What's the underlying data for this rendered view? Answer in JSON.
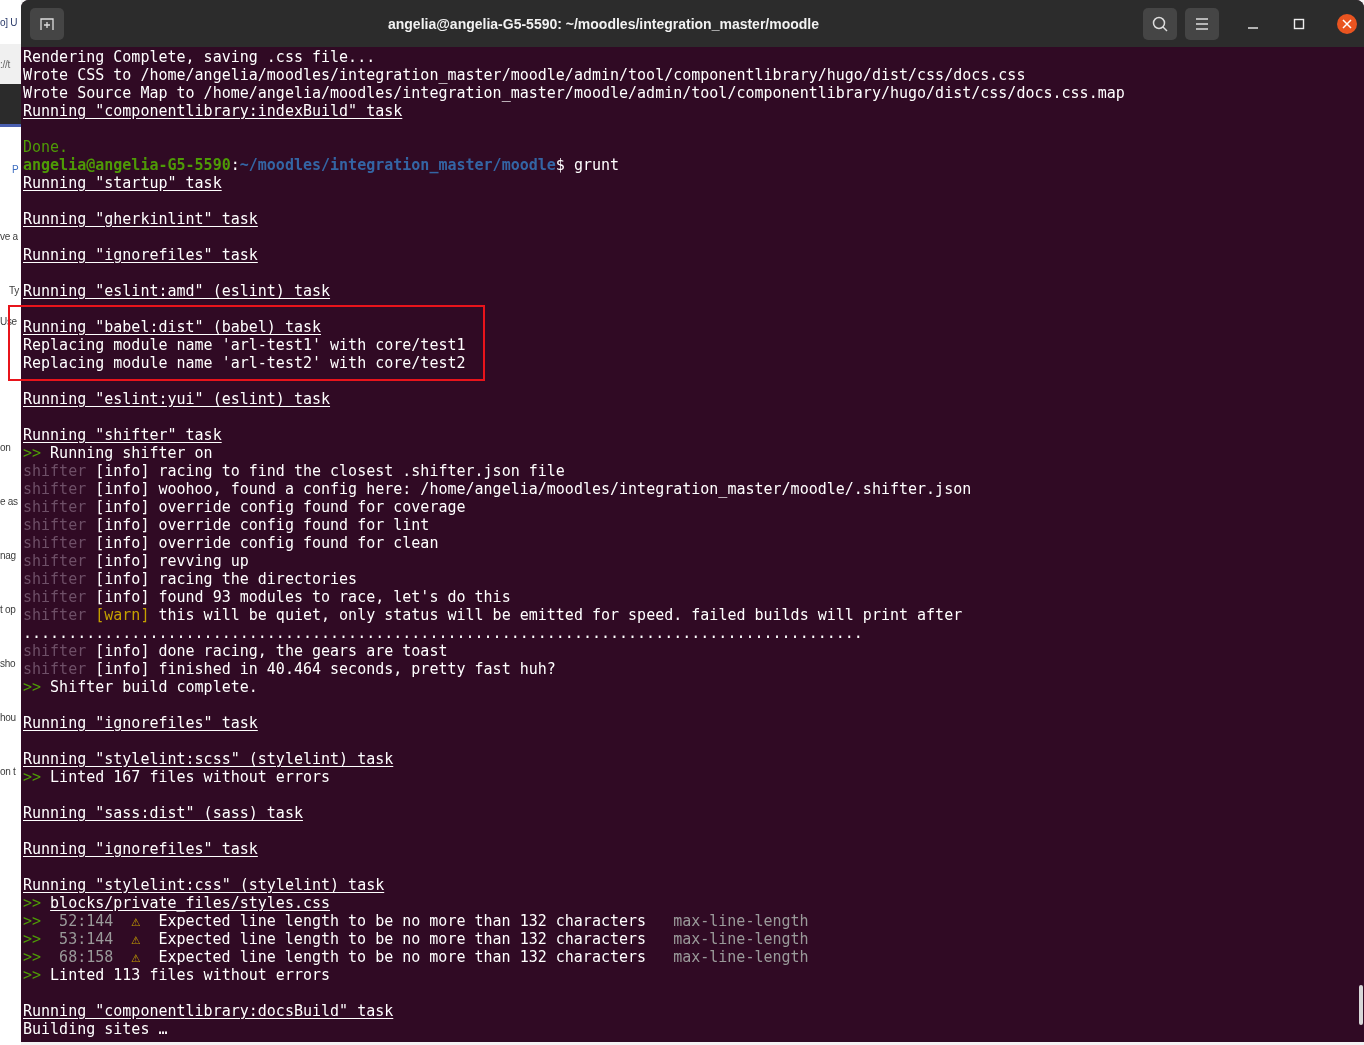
{
  "background_window": {
    "fragments": [
      "o] U",
      "://t",
      "P",
      "ve a",
      "Ty",
      "Use",
      "on",
      "e as",
      "nag",
      "t op",
      "sho",
      "hou",
      "on t"
    ]
  },
  "window": {
    "title": "angelia@angelia-G5-5590: ~/moodles/integration_master/moodle"
  },
  "lines": [
    {
      "kind": "text",
      "segments": [
        {
          "kind": "plain",
          "text": "Rendering Complete, saving .css file..."
        }
      ]
    },
    {
      "kind": "text",
      "segments": [
        {
          "kind": "plain",
          "text": "Wrote CSS to /home/angelia/moodles/integration_master/moodle/admin/tool/componentlibrary/hugo/dist/css/docs.css"
        }
      ]
    },
    {
      "kind": "text",
      "segments": [
        {
          "kind": "plain",
          "text": "Wrote Source Map to /home/angelia/moodles/integration_master/moodle/admin/tool/componentlibrary/hugo/dist/css/docs.css.map"
        }
      ]
    },
    {
      "kind": "text",
      "segments": [
        {
          "kind": "task",
          "text": "Running \"componentlibrary:indexBuild\" task"
        }
      ]
    },
    {
      "kind": "blank"
    },
    {
      "kind": "text",
      "segments": [
        {
          "kind": "done",
          "text": "Done."
        }
      ]
    },
    {
      "kind": "text",
      "segments": [
        {
          "kind": "user",
          "text": "angelia@angelia-G5-5590"
        },
        {
          "kind": "plain",
          "text": ":"
        },
        {
          "kind": "path",
          "text": "~/moodles/integration_master/moodle"
        },
        {
          "kind": "plain",
          "text": "$ grunt"
        }
      ]
    },
    {
      "kind": "text",
      "segments": [
        {
          "kind": "task",
          "text": "Running \"startup\" task"
        }
      ]
    },
    {
      "kind": "blank"
    },
    {
      "kind": "text",
      "segments": [
        {
          "kind": "task",
          "text": "Running \"gherkinlint\" task"
        }
      ]
    },
    {
      "kind": "blank"
    },
    {
      "kind": "text",
      "segments": [
        {
          "kind": "task",
          "text": "Running \"ignorefiles\" task"
        }
      ]
    },
    {
      "kind": "blank"
    },
    {
      "kind": "text",
      "segments": [
        {
          "kind": "task",
          "text": "Running \"eslint:amd\" (eslint) task"
        }
      ]
    },
    {
      "kind": "blank"
    },
    {
      "kind": "highlight",
      "lines": [
        {
          "kind": "text",
          "segments": [
            {
              "kind": "task",
              "text": "Running \"babel:dist\" (babel) task"
            }
          ]
        },
        {
          "kind": "text",
          "segments": [
            {
              "kind": "plain",
              "text": "Replacing module name 'arl-test1' with core/test1"
            }
          ]
        },
        {
          "kind": "text",
          "segments": [
            {
              "kind": "plain",
              "text": "Replacing module name 'arl-test2' with core/test2"
            }
          ]
        }
      ]
    },
    {
      "kind": "blank"
    },
    {
      "kind": "text",
      "segments": [
        {
          "kind": "task",
          "text": "Running \"eslint:yui\" (eslint) task"
        }
      ]
    },
    {
      "kind": "blank"
    },
    {
      "kind": "text",
      "segments": [
        {
          "kind": "task",
          "text": "Running \"shifter\" task"
        }
      ]
    },
    {
      "kind": "text",
      "segments": [
        {
          "kind": "arrow",
          "text": ">>"
        },
        {
          "kind": "plain",
          "text": " Running shifter on"
        }
      ]
    },
    {
      "kind": "text",
      "segments": [
        {
          "kind": "dim",
          "text": "shifter"
        },
        {
          "kind": "plain",
          "text": " [info] racing to find the closest .shifter.json file"
        }
      ]
    },
    {
      "kind": "text",
      "segments": [
        {
          "kind": "dim",
          "text": "shifter"
        },
        {
          "kind": "plain",
          "text": " [info] woohoo, found a config here: /home/angelia/moodles/integration_master/moodle/.shifter.json"
        }
      ]
    },
    {
      "kind": "text",
      "segments": [
        {
          "kind": "dim",
          "text": "shifter"
        },
        {
          "kind": "plain",
          "text": " [info] override config found for coverage"
        }
      ]
    },
    {
      "kind": "text",
      "segments": [
        {
          "kind": "dim",
          "text": "shifter"
        },
        {
          "kind": "plain",
          "text": " [info] override config found for lint"
        }
      ]
    },
    {
      "kind": "text",
      "segments": [
        {
          "kind": "dim",
          "text": "shifter"
        },
        {
          "kind": "plain",
          "text": " [info] override config found for clean"
        }
      ]
    },
    {
      "kind": "text",
      "segments": [
        {
          "kind": "dim",
          "text": "shifter"
        },
        {
          "kind": "plain",
          "text": " [info] revving up"
        }
      ]
    },
    {
      "kind": "text",
      "segments": [
        {
          "kind": "dim",
          "text": "shifter"
        },
        {
          "kind": "plain",
          "text": " [info] racing the directories"
        }
      ]
    },
    {
      "kind": "text",
      "segments": [
        {
          "kind": "dim",
          "text": "shifter"
        },
        {
          "kind": "plain",
          "text": " [info] found 93 modules to race, let's do this"
        }
      ]
    },
    {
      "kind": "text",
      "segments": [
        {
          "kind": "dim",
          "text": "shifter"
        },
        {
          "kind": "warn",
          "text": " [warn]"
        },
        {
          "kind": "plain",
          "text": " this will be quiet, only status will be emitted for speed. failed builds will print after"
        }
      ]
    },
    {
      "kind": "text",
      "segments": [
        {
          "kind": "plain",
          "text": "............................................................................................."
        }
      ]
    },
    {
      "kind": "text",
      "segments": [
        {
          "kind": "dim",
          "text": "shifter"
        },
        {
          "kind": "plain",
          "text": " [info] done racing, the gears are toast"
        }
      ]
    },
    {
      "kind": "text",
      "segments": [
        {
          "kind": "dim",
          "text": "shifter"
        },
        {
          "kind": "plain",
          "text": " [info] finished in 40.464 seconds, pretty fast huh?"
        }
      ]
    },
    {
      "kind": "text",
      "segments": [
        {
          "kind": "arrow",
          "text": ">>"
        },
        {
          "kind": "plain",
          "text": " Shifter build complete."
        }
      ]
    },
    {
      "kind": "blank"
    },
    {
      "kind": "text",
      "segments": [
        {
          "kind": "task",
          "text": "Running \"ignorefiles\" task"
        }
      ]
    },
    {
      "kind": "blank"
    },
    {
      "kind": "text",
      "segments": [
        {
          "kind": "task",
          "text": "Running \"stylelint:scss\" (stylelint) task"
        }
      ]
    },
    {
      "kind": "text",
      "segments": [
        {
          "kind": "arrow",
          "text": ">>"
        },
        {
          "kind": "plain",
          "text": " Linted 167 files without errors"
        }
      ]
    },
    {
      "kind": "blank"
    },
    {
      "kind": "text",
      "segments": [
        {
          "kind": "task",
          "text": "Running \"sass:dist\" (sass) task"
        }
      ]
    },
    {
      "kind": "blank"
    },
    {
      "kind": "text",
      "segments": [
        {
          "kind": "task",
          "text": "Running \"ignorefiles\" task"
        }
      ]
    },
    {
      "kind": "blank"
    },
    {
      "kind": "text",
      "segments": [
        {
          "kind": "task",
          "text": "Running \"stylelint:css\" (stylelint) task"
        }
      ]
    },
    {
      "kind": "text",
      "segments": [
        {
          "kind": "arrow",
          "text": ">>"
        },
        {
          "kind": "link",
          "text": "blocks/private_files/styles.css"
        }
      ]
    },
    {
      "kind": "text",
      "segments": [
        {
          "kind": "arrow",
          "text": ">>"
        },
        {
          "kind": "code",
          "text": "52:144"
        },
        {
          "kind": "warnicon",
          "text": "⚠"
        },
        {
          "kind": "plain",
          "text": "Expected line length to be no more than 132 characters"
        },
        {
          "kind": "code",
          "text": "max-line-length"
        }
      ]
    },
    {
      "kind": "text",
      "segments": [
        {
          "kind": "arrow",
          "text": ">>"
        },
        {
          "kind": "code",
          "text": "53:144"
        },
        {
          "kind": "warnicon",
          "text": "⚠"
        },
        {
          "kind": "plain",
          "text": "Expected line length to be no more than 132 characters"
        },
        {
          "kind": "code",
          "text": "max-line-length"
        }
      ]
    },
    {
      "kind": "text",
      "segments": [
        {
          "kind": "arrow",
          "text": ">>"
        },
        {
          "kind": "code",
          "text": "68:158"
        },
        {
          "kind": "warnicon",
          "text": "⚠"
        },
        {
          "kind": "plain",
          "text": "Expected line length to be no more than 132 characters"
        },
        {
          "kind": "code",
          "text": "max-line-length"
        }
      ]
    },
    {
      "kind": "text",
      "segments": [
        {
          "kind": "arrow",
          "text": ">>"
        },
        {
          "kind": "plain",
          "text": " Linted 113 files without errors"
        }
      ]
    },
    {
      "kind": "blank"
    },
    {
      "kind": "text",
      "segments": [
        {
          "kind": "task",
          "text": "Running \"componentlibrary:docsBuild\" task"
        }
      ]
    },
    {
      "kind": "text",
      "segments": [
        {
          "kind": "plain",
          "text": "Building sites …"
        }
      ]
    }
  ]
}
